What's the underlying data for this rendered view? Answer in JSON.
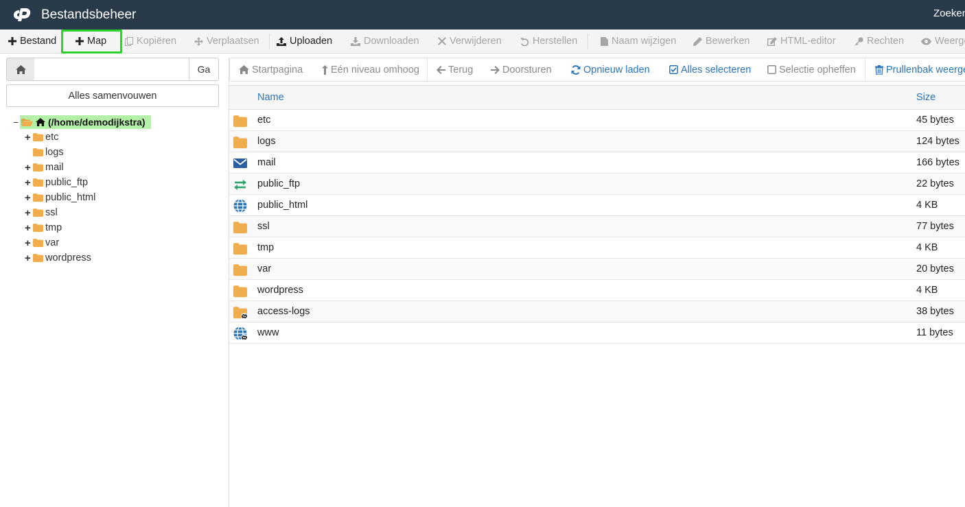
{
  "header": {
    "title": "Bestandsbeheer",
    "search_label": "Zoeken"
  },
  "toolbar": {
    "items": [
      {
        "label": "Bestand",
        "icon": "plus-icon",
        "enabled": true
      },
      {
        "label": "Map",
        "icon": "plus-icon",
        "enabled": true,
        "highlighted": true
      },
      {
        "label": "Kopiëren",
        "icon": "copy-icon",
        "enabled": false
      },
      {
        "label": "Verplaatsen",
        "icon": "move-icon",
        "enabled": false
      },
      {
        "label": "Uploaden",
        "icon": "upload-icon",
        "enabled": true
      },
      {
        "label": "Downloaden",
        "icon": "download-icon",
        "enabled": false
      },
      {
        "label": "Verwijderen",
        "icon": "x-icon",
        "enabled": false
      },
      {
        "label": "Herstellen",
        "icon": "undo-icon",
        "enabled": false
      },
      {
        "label": "Naam wijzigen",
        "icon": "file-icon",
        "enabled": false
      },
      {
        "label": "Bewerken",
        "icon": "pencil-icon",
        "enabled": false
      },
      {
        "label": "HTML-editor",
        "icon": "edit-icon",
        "enabled": false
      },
      {
        "label": "Rechten",
        "icon": "key-icon",
        "enabled": false
      },
      {
        "label": "Weerge",
        "icon": "eye-icon",
        "enabled": false
      }
    ]
  },
  "sidebar": {
    "path_value": "",
    "go_label": "Ga",
    "collapse_label": "Alles samenvouwen",
    "root_label": "(/home/demodijkstra)",
    "tree": [
      {
        "label": "etc",
        "expandable": true
      },
      {
        "label": "logs",
        "expandable": false
      },
      {
        "label": "mail",
        "expandable": true
      },
      {
        "label": "public_ftp",
        "expandable": true
      },
      {
        "label": "public_html",
        "expandable": true
      },
      {
        "label": "ssl",
        "expandable": true
      },
      {
        "label": "tmp",
        "expandable": true
      },
      {
        "label": "var",
        "expandable": true
      },
      {
        "label": "wordpress",
        "expandable": true
      }
    ]
  },
  "navbar": {
    "items": [
      {
        "label": "Startpagina",
        "icon": "home-icon",
        "style": "gray"
      },
      {
        "label": "Eén niveau omhoog",
        "icon": "level-up-icon",
        "style": "gray"
      },
      {
        "label": "Terug",
        "icon": "arrow-left-icon",
        "style": "gray"
      },
      {
        "label": "Doorsturen",
        "icon": "arrow-right-icon",
        "style": "gray"
      },
      {
        "label": "Opnieuw laden",
        "icon": "refresh-icon",
        "style": "blue"
      },
      {
        "label": "Alles selecteren",
        "icon": "checkbox-checked-icon",
        "style": "blue"
      },
      {
        "label": "Selectie opheffen",
        "icon": "checkbox-empty-icon",
        "style": "gray"
      },
      {
        "label": "Prullenbak weerge",
        "icon": "trash-icon",
        "style": "blue"
      }
    ]
  },
  "table": {
    "columns": {
      "name": "Name",
      "size": "Size"
    },
    "rows": [
      {
        "name": "etc",
        "size": "45 bytes",
        "type": "folder"
      },
      {
        "name": "logs",
        "size": "124 bytes",
        "type": "folder"
      },
      {
        "name": "mail",
        "size": "166 bytes",
        "type": "mail"
      },
      {
        "name": "public_ftp",
        "size": "22 bytes",
        "type": "ftp"
      },
      {
        "name": "public_html",
        "size": "4 KB",
        "type": "globe"
      },
      {
        "name": "ssl",
        "size": "77 bytes",
        "type": "folder"
      },
      {
        "name": "tmp",
        "size": "4 KB",
        "type": "folder"
      },
      {
        "name": "var",
        "size": "20 bytes",
        "type": "folder"
      },
      {
        "name": "wordpress",
        "size": "4 KB",
        "type": "folder"
      },
      {
        "name": "access-logs",
        "size": "38 bytes",
        "type": "folder-link"
      },
      {
        "name": "www",
        "size": "11 bytes",
        "type": "globe-link"
      }
    ]
  },
  "colors": {
    "header_bg": "#293a4a",
    "folder": "#f0ad4e",
    "link_blue": "#2a74b8",
    "highlight_green": "#2bd32b",
    "root_highlight": "#b5f0a8",
    "ftp_green": "#2fa36b",
    "mail_blue": "#2c5fa0"
  }
}
